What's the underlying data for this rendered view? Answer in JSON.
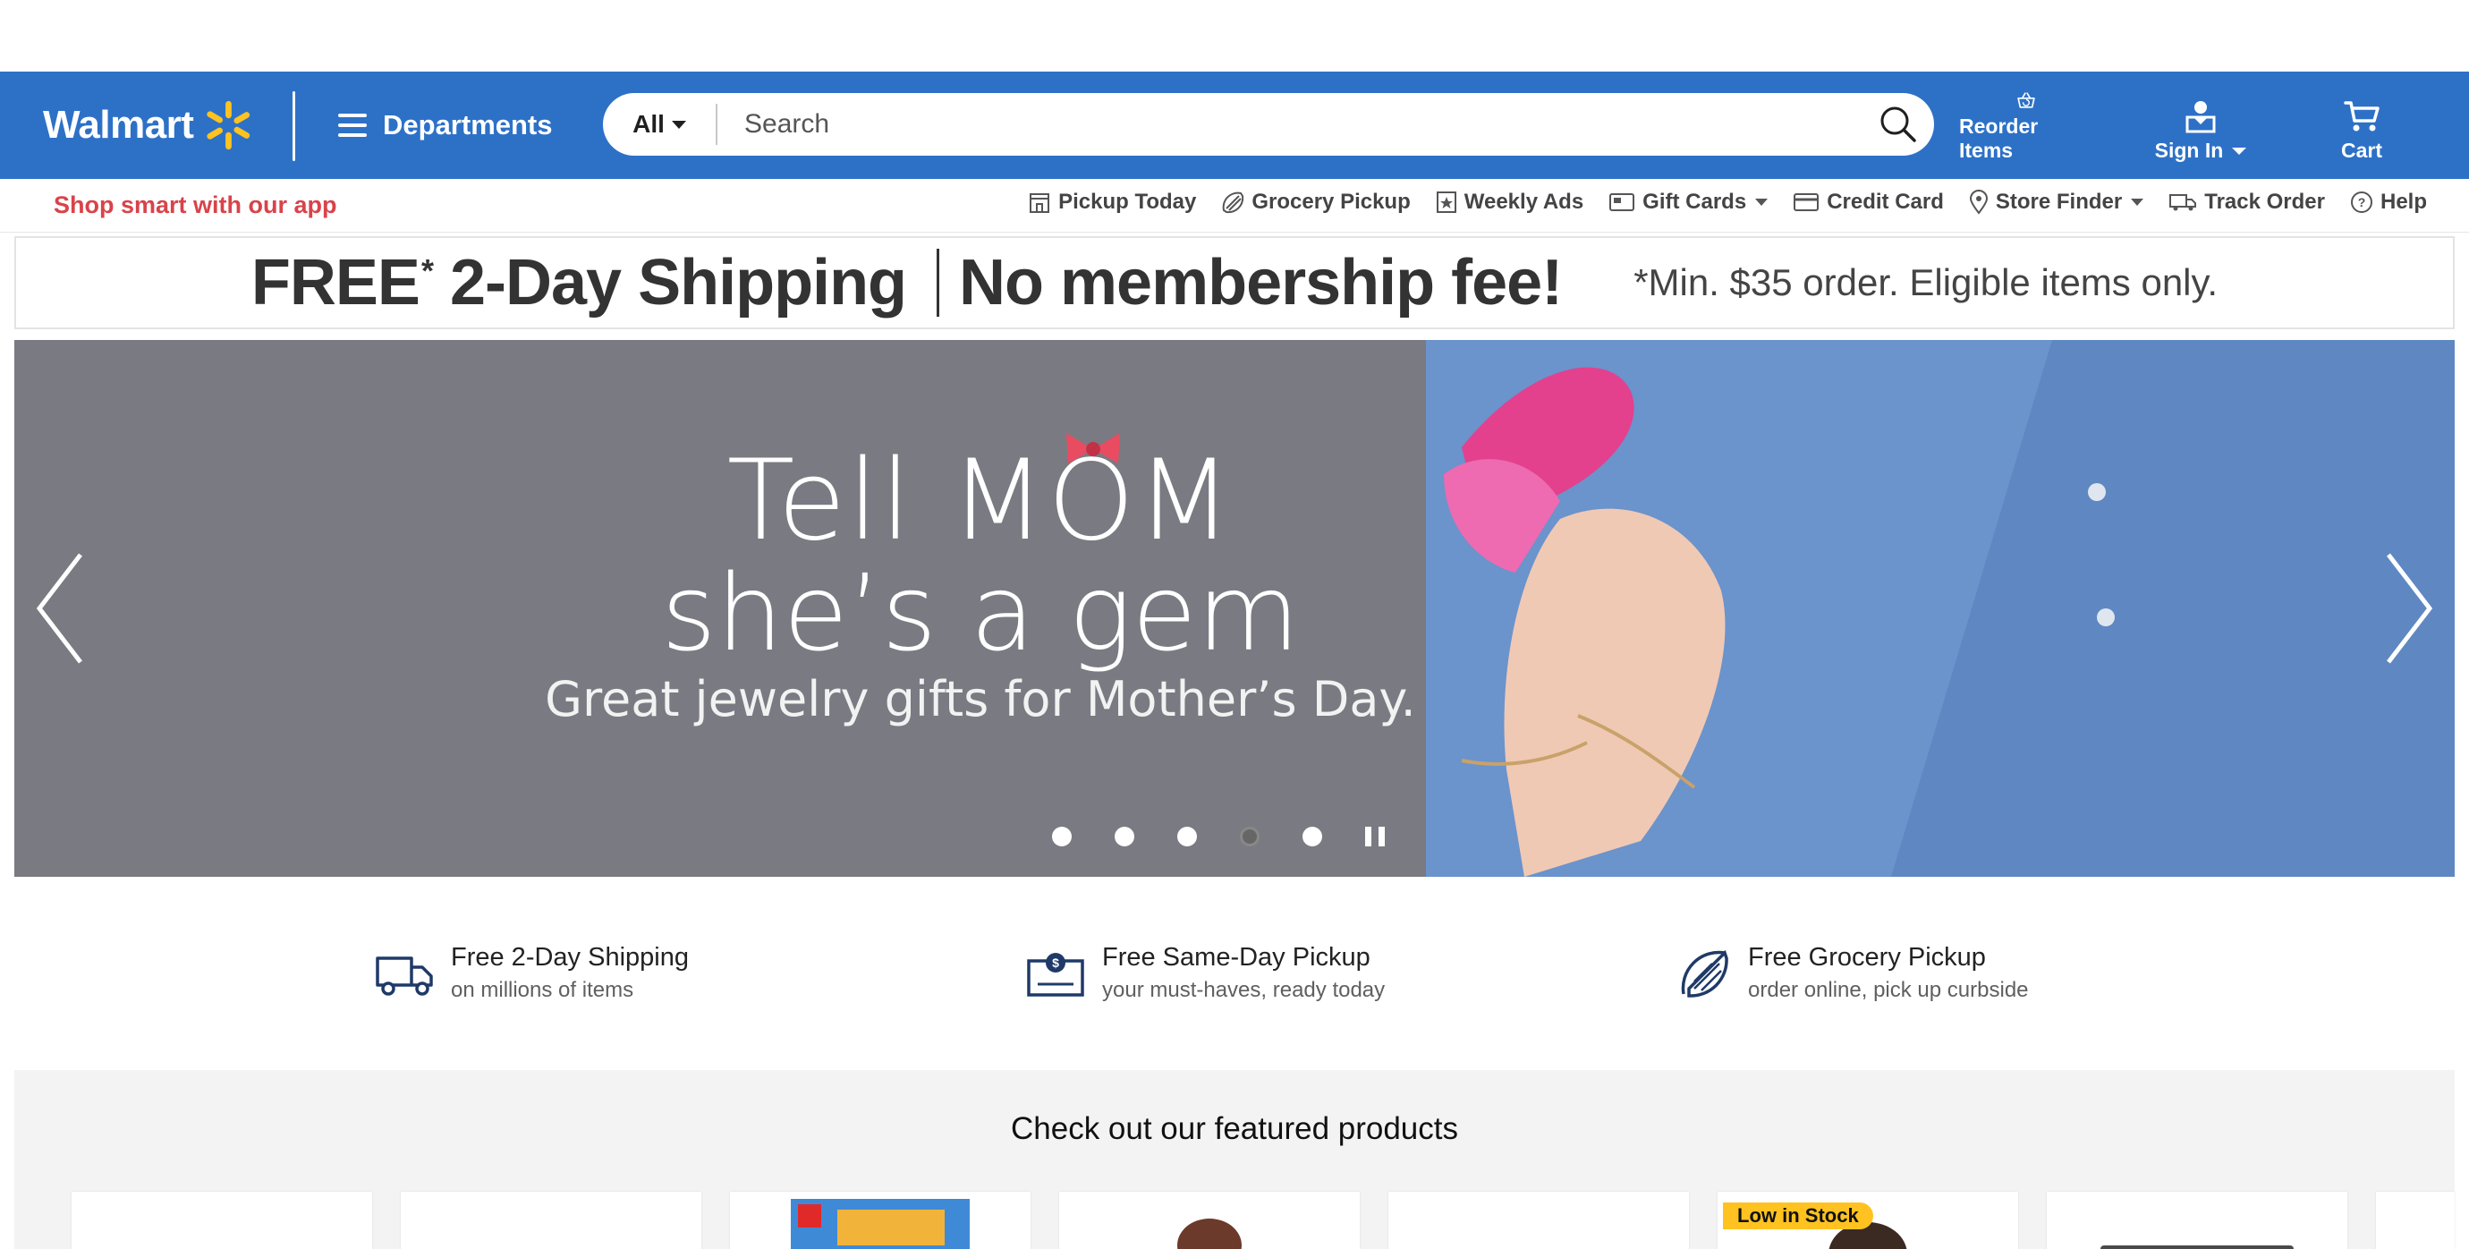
{
  "header": {
    "logo_text": "Walmart",
    "departments_label": "Departments",
    "search": {
      "category": "All",
      "placeholder": "Search"
    },
    "reorder_label": "Reorder Items",
    "signin_label": "Sign In",
    "cart_label": "Cart",
    "colors": {
      "bar": "#2d71c7",
      "spark": "#ffc220"
    }
  },
  "subnav": {
    "app_link": "Shop smart with our app",
    "items": [
      {
        "label": "Pickup Today",
        "icon": "store-icon"
      },
      {
        "label": "Grocery Pickup",
        "icon": "grocery-icon"
      },
      {
        "label": "Weekly Ads",
        "icon": "weekly-ads-icon"
      },
      {
        "label": "Gift Cards",
        "icon": "gift-card-icon"
      },
      {
        "label": "Credit Card",
        "icon": "credit-card-icon"
      },
      {
        "label": "Store Finder",
        "icon": "location-pin-icon"
      },
      {
        "label": "Track Order",
        "icon": "truck-icon"
      },
      {
        "label": "Help",
        "icon": "help-icon"
      }
    ]
  },
  "banner": {
    "free": "FREE",
    "asterisk": "*",
    "shipping": "2-Day Shipping",
    "no_fee": "No membership fee!",
    "fine_print": "*Min. $35 order. Eligible items only."
  },
  "hero": {
    "line1": "Tell MOM",
    "line2": "she’s a gem",
    "line3": "Great jewelry gifts for Mother’s Day.",
    "slide_count": 5,
    "active_slide": 4
  },
  "features": [
    {
      "title": "Free 2-Day Shipping",
      "subtitle": "on millions of items",
      "icon": "truck-icon"
    },
    {
      "title": "Free Same-Day Pickup",
      "subtitle": "your must-haves, ready today",
      "icon": "pickup-box-icon"
    },
    {
      "title": "Free Grocery Pickup",
      "subtitle": "order online, pick up curbside",
      "icon": "citrus-icon"
    }
  ],
  "featured": {
    "heading": "Check out our featured products",
    "badge": "Low in Stock"
  }
}
